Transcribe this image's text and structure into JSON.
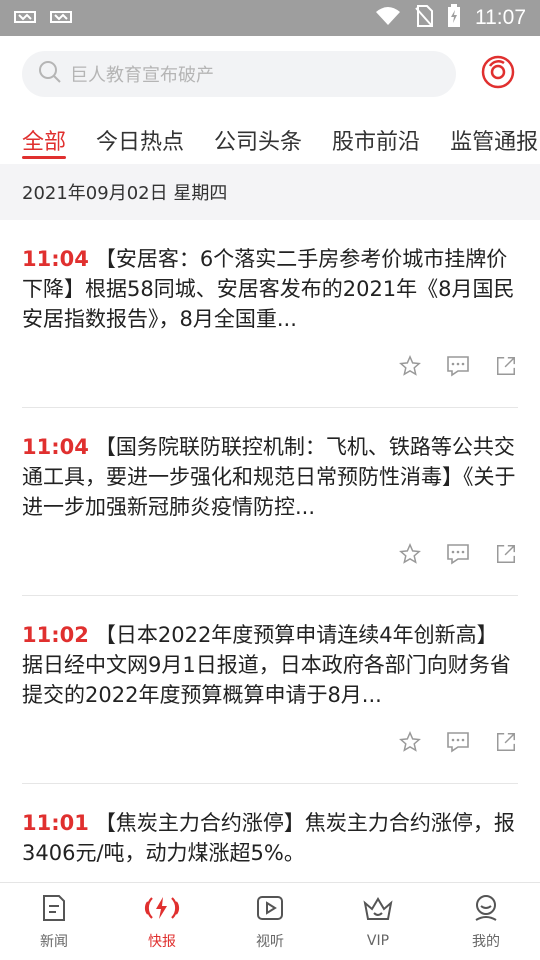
{
  "status_bar": {
    "time": "11:07",
    "icons": [
      "notification-icon",
      "notification-icon",
      "wifi-icon",
      "no-sim-icon",
      "battery-charging-icon"
    ]
  },
  "search": {
    "placeholder": "巨人教育宣布破产",
    "voice_icon": "voice-record-icon"
  },
  "tabs": [
    {
      "label": "全部",
      "active": true
    },
    {
      "label": "今日热点",
      "active": false
    },
    {
      "label": "公司头条",
      "active": false
    },
    {
      "label": "股市前沿",
      "active": false
    },
    {
      "label": "监管通报",
      "active": false
    }
  ],
  "date_header": "2021年09月02日 星期四",
  "news": [
    {
      "time": "11:04",
      "text": "【安居客：6个落实二手房参考价城市挂牌价下降】根据58同城、安居客发布的2021年《8月国民安居指数报告》，8月全国重..."
    },
    {
      "time": "11:04",
      "text": "【国务院联防联控机制：飞机、铁路等公共交通工具，要进一步强化和规范日常预防性消毒】《关于进一步加强新冠肺炎疫情防控..."
    },
    {
      "time": "11:02",
      "text": "【日本2022年度预算申请连续4年创新高】据日经中文网9月1日报道，日本政府各部门向财务省提交的2022年度预算概算申请于8月..."
    },
    {
      "time": "11:01",
      "text": "【焦炭主力合约涨停】焦炭主力合约涨停，报3406元/吨，动力煤涨超5%。"
    }
  ],
  "bottom_nav": [
    {
      "label": "新闻",
      "icon": "news-icon",
      "active": false
    },
    {
      "label": "快报",
      "icon": "flash-news-icon",
      "active": true
    },
    {
      "label": "视听",
      "icon": "video-play-icon",
      "active": false
    },
    {
      "label": "VIP",
      "icon": "vip-crown-icon",
      "active": false
    },
    {
      "label": "我的",
      "icon": "profile-icon",
      "active": false
    }
  ],
  "colors": {
    "accent": "#e0302f",
    "status_bar": "#9e9e9e",
    "date_bar": "#f4f4f6"
  }
}
